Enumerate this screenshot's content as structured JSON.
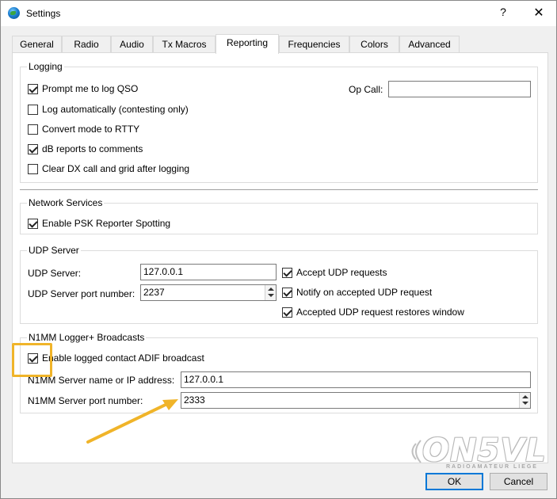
{
  "window": {
    "title": "Settings",
    "help_glyph": "?",
    "close_glyph": "✕"
  },
  "tabs": [
    {
      "label": "General"
    },
    {
      "label": "Radio"
    },
    {
      "label": "Audio"
    },
    {
      "label": "Tx Macros"
    },
    {
      "label": "Reporting",
      "active": true
    },
    {
      "label": "Frequencies"
    },
    {
      "label": "Colors"
    },
    {
      "label": "Advanced"
    }
  ],
  "logging": {
    "title": "Logging",
    "prompt_log_qso": {
      "label": "Prompt me to log QSO",
      "checked": true
    },
    "log_automatically": {
      "label": "Log automatically (contesting only)",
      "checked": false
    },
    "convert_rtty": {
      "label": "Convert mode to RTTY",
      "checked": false
    },
    "db_reports": {
      "label": "dB reports to comments",
      "checked": true
    },
    "clear_dx": {
      "label": "Clear DX call and grid after logging",
      "checked": false
    },
    "op_call_label": "Op Call:",
    "op_call_value": ""
  },
  "network": {
    "title": "Network Services",
    "psk_reporter": {
      "label": "Enable PSK Reporter Spotting",
      "checked": true
    }
  },
  "udp": {
    "title": "UDP Server",
    "server_label": "UDP Server:",
    "server_value": "127.0.0.1",
    "port_label": "UDP Server port number:",
    "port_value": "2237",
    "accept_requests": {
      "label": "Accept UDP requests",
      "checked": true
    },
    "notify_accepted": {
      "label": "Notify on accepted UDP request",
      "checked": true
    },
    "restore_window": {
      "label": "Accepted UDP request restores window",
      "checked": true
    }
  },
  "n1mm": {
    "title": "N1MM Logger+  Broadcasts",
    "enable_adif": {
      "label": "Enable logged contact ADIF broadcast",
      "checked": true
    },
    "server_label": "N1MM Server name or IP address:",
    "server_value": "127.0.0.1",
    "port_label": "N1MM Server port number:",
    "port_value": "2333"
  },
  "buttons": {
    "ok": "OK",
    "cancel": "Cancel"
  },
  "watermark": {
    "main": "ON5VL",
    "sub": "RADIOAMATEUR LIEGE"
  },
  "colors": {
    "highlight": "#f0b429",
    "focus": "#0078d7"
  }
}
